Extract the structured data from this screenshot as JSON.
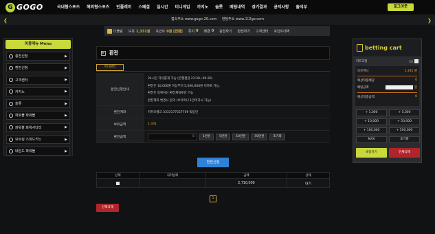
{
  "logo": {
    "text": "GOGO",
    "mark": "G"
  },
  "nav": {
    "items": [
      "국내형스포츠",
      "해외형스포츠",
      "인플레이",
      "스페셜",
      "실시간",
      "미니게임",
      "카지노",
      "슬롯",
      "베팅내역",
      "경기결과",
      "공지사항",
      "출석부"
    ],
    "logout": "로그아웃"
  },
  "address_bar": {
    "primary": "접속주소 www.gogo-20.com",
    "secondary": "텐팅주소 www.고고go.com"
  },
  "user_bar": {
    "username": "디플랑",
    "money_label": "보유",
    "money_value": "1,331원",
    "point_label": "포인트",
    "point_value": "0원 [전환]",
    "note_label": "쪽지",
    "note_value": "0",
    "bet_label": "배경",
    "bet_value": "0",
    "charge": "충전하기",
    "exchange": "환전하기",
    "support": "고객센터",
    "points_history": "포인트내역"
  },
  "sidebar": {
    "header": "이용메뉴 Menu",
    "items": [
      "충전신청",
      "환전신청",
      "고객센터",
      "카지노",
      "슬롯",
      "파워볼 파워볼",
      "파워볼 파워사다리",
      "보트킹 스피드키노",
      "네임드 파워볼"
    ]
  },
  "page": {
    "title": "환전",
    "tab": "미니환전",
    "guide_label": "환전신청안내",
    "guide_lines": [
      "24시간 자유롭게 가능 (은행점검 23:30~00:30)",
      "환전은 10,000원 이상부터 5,000,000원 이하로 가능.",
      "환전은 등록하신 환전계좌로만 가능",
      "환전계좌 변경시 문의 (보유머니 1만이하시 가능)"
    ],
    "account_label": "환전계좌",
    "account_value": "카카오뱅크 3333177557709 박동민",
    "balance_label": "보유금액",
    "balance_value": "1,331",
    "amount_label": "환전금액",
    "amount_value": "0",
    "quick_buttons": [
      "1만원",
      "5만원",
      "10만원",
      "50만원",
      "초기화"
    ],
    "submit": "환전신청"
  },
  "history": {
    "headers": [
      "선택",
      "처리날짜",
      "금액",
      "상태"
    ],
    "rows": [
      {
        "date": "",
        "amount": "2,710,000",
        "status": "대기"
      }
    ],
    "page": "1",
    "delete": "선택삭제"
  },
  "cart": {
    "title": "betting cart",
    "fix_label": "카트고정",
    "fix_state": "ON",
    "lines": [
      {
        "label": "보유머니",
        "value": "1,331 원"
      },
      {
        "label": "예상적중배당",
        "value": "0"
      },
      {
        "label": "배팅금액",
        "value": "원"
      },
      {
        "label": "예상적중금액",
        "value": "0"
      }
    ],
    "amount_buttons": [
      "+ 1,000",
      "+ 5,000",
      "+ 10,000",
      "+ 50,000",
      "+ 100,000",
      "+ 500,000",
      "MAX",
      "초기화"
    ],
    "bet": "베팅하기",
    "clear": "전체삭제"
  },
  "colors": {
    "accent": "#c9d83a",
    "gold": "#e0b23a",
    "danger": "#b0252a",
    "primary": "#2f82d6"
  }
}
